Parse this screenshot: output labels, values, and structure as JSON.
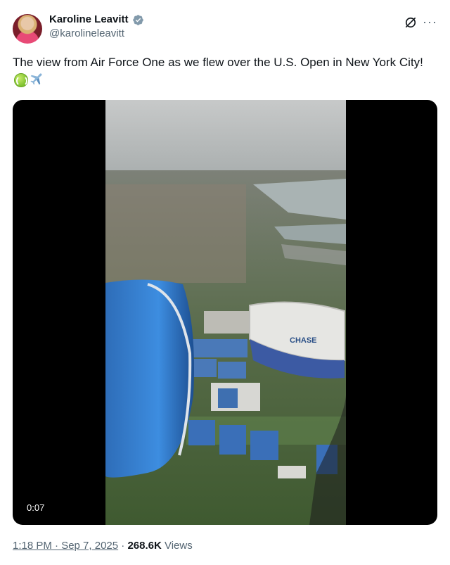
{
  "author": {
    "display_name": "Karoline Leavitt",
    "handle": "@karolineleavitt",
    "verified": true
  },
  "icons": {
    "verified": "verified-badge-icon",
    "grok": "grok-icon",
    "more": "more-options-icon",
    "emoji_1": "tennis-ball-emoji",
    "emoji_2": "airplane-emoji"
  },
  "tweet": {
    "text": "The view from Air Force One as we flew over the U.S. Open in New York City!"
  },
  "video": {
    "timestamp": "0:07",
    "stadium_sign": "CHASE"
  },
  "meta": {
    "time": "1:18 PM · Sep 7, 2025",
    "separator": " · ",
    "views_count": "268.6K",
    "views_label": " Views"
  },
  "colors": {
    "verified": "#829aab",
    "text": "#0f1419",
    "secondary": "#536471"
  }
}
